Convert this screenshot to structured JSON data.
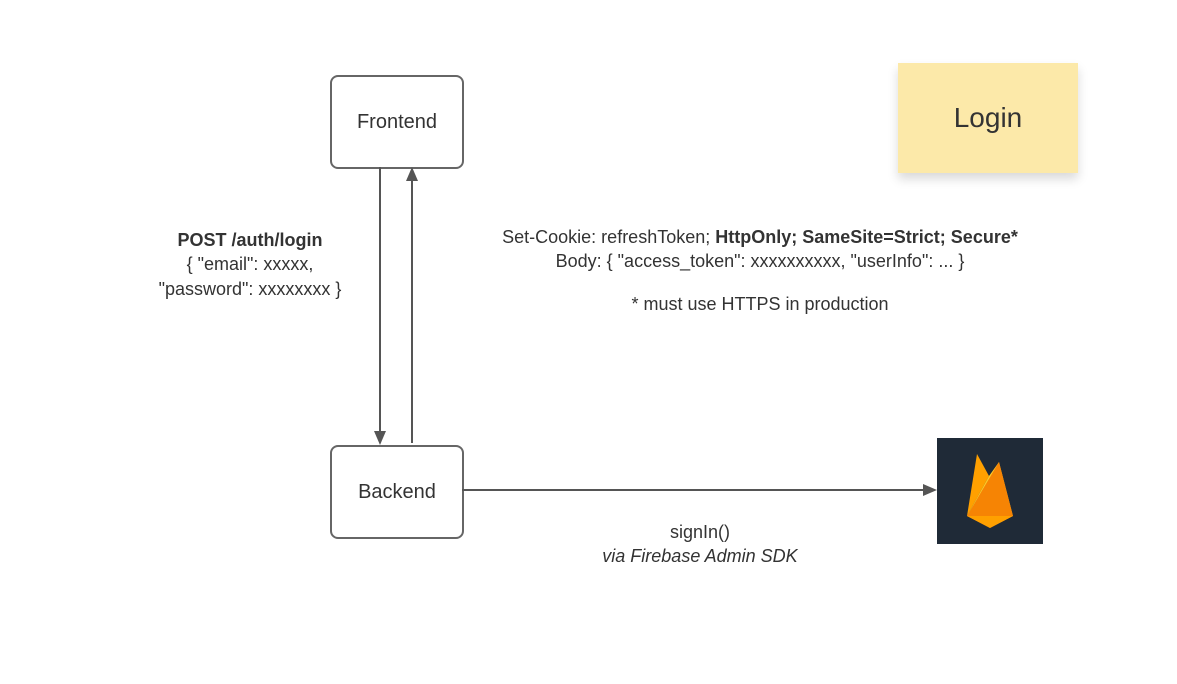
{
  "nodes": {
    "frontend": {
      "label": "Frontend"
    },
    "backend": {
      "label": "Backend"
    },
    "firebase": {
      "label": "Firebase"
    }
  },
  "sticky": {
    "title": "Login"
  },
  "request": {
    "title": "POST /auth/login",
    "body_line1": "{ \"email\": xxxxx,",
    "body_line2": "\"password\": xxxxxxxx }"
  },
  "response": {
    "header_prefix": "Set-Cookie: refreshToken; ",
    "header_bold": "HttpOnly; SameSite=Strict; Secure*",
    "body": "Body: { \"access_token\": xxxxxxxxxx, \"userInfo\": ... }",
    "footnote": "* must use HTTPS in production"
  },
  "signin": {
    "call": "signIn()",
    "via": "via Firebase Admin SDK"
  }
}
